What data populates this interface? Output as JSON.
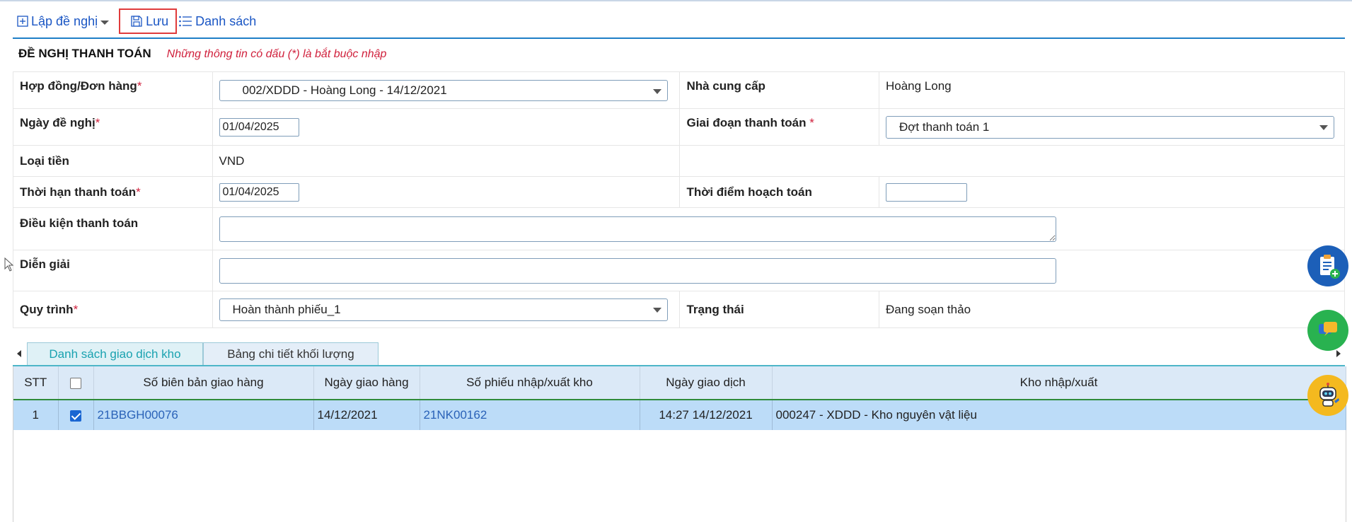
{
  "toolbar": {
    "lap_de_nghi": "Lập đề nghị",
    "luu": "Lưu",
    "danh_sach": "Danh sách"
  },
  "header": {
    "title": "ĐỀ NGHỊ THANH TOÁN",
    "note": "Những thông tin có dấu (*) là bắt buộc nhập"
  },
  "form": {
    "hop_dong_label": "Hợp đồng/Đơn hàng",
    "hop_dong_value": "002/XDDD - Hoàng Long - 14/12/2021",
    "nha_cung_cap_label": "Nhà cung cấp",
    "nha_cung_cap_value": "Hoàng Long",
    "ngay_de_nghi_label": "Ngày đề nghị",
    "ngay_de_nghi_value": "01/04/2025",
    "giai_doan_label": "Giai đoạn thanh toán ",
    "giai_doan_value": "Đợt thanh toán 1",
    "loai_tien_label": "Loại tiền",
    "loai_tien_value": "VND",
    "thoi_han_label": "Thời hạn thanh toán",
    "thoi_han_value": "01/04/2025",
    "thoi_diem_label": "Thời điểm hoạch toán",
    "thoi_diem_value": "",
    "dieu_kien_label": "Điều kiện thanh toán",
    "dien_giai_label": "Diễn giải",
    "quy_trinh_label": "Quy trình",
    "quy_trinh_value": "Hoàn thành phiếu_1",
    "trang_thai_label": "Trạng thái",
    "trang_thai_value": "Đang soạn thảo",
    "required_mark": "*"
  },
  "tabs": [
    {
      "label": "Danh sách giao dịch kho",
      "active": true
    },
    {
      "label": "Bảng chi tiết khối lượng",
      "active": false
    }
  ],
  "grid": {
    "columns": [
      "STT",
      "",
      "Số biên bản giao hàng",
      "Ngày giao hàng",
      "Số phiếu nhập/xuất kho",
      "Ngày giao dịch",
      "Kho nhập/xuất"
    ],
    "rows": [
      {
        "stt": "1",
        "checked": true,
        "so_bien_ban": "21BBGH00076",
        "ngay_giao_hang": "14/12/2021",
        "so_phieu": "21NK00162",
        "ngay_giao_dich": "14:27 14/12/2021",
        "kho": "000247 - XDDD - Kho nguyên vật liệu"
      }
    ]
  },
  "colors": {
    "accent_blue": "#1f7fc7",
    "required_red": "#d0203c",
    "row_selected": "#bcdcf8",
    "tab_active_text": "#1aa2b0"
  },
  "icons": [
    "plus-square-icon",
    "save-icon",
    "list-icon",
    "clipboard-add-icon",
    "chat-icon",
    "robot-assistant-icon"
  ]
}
